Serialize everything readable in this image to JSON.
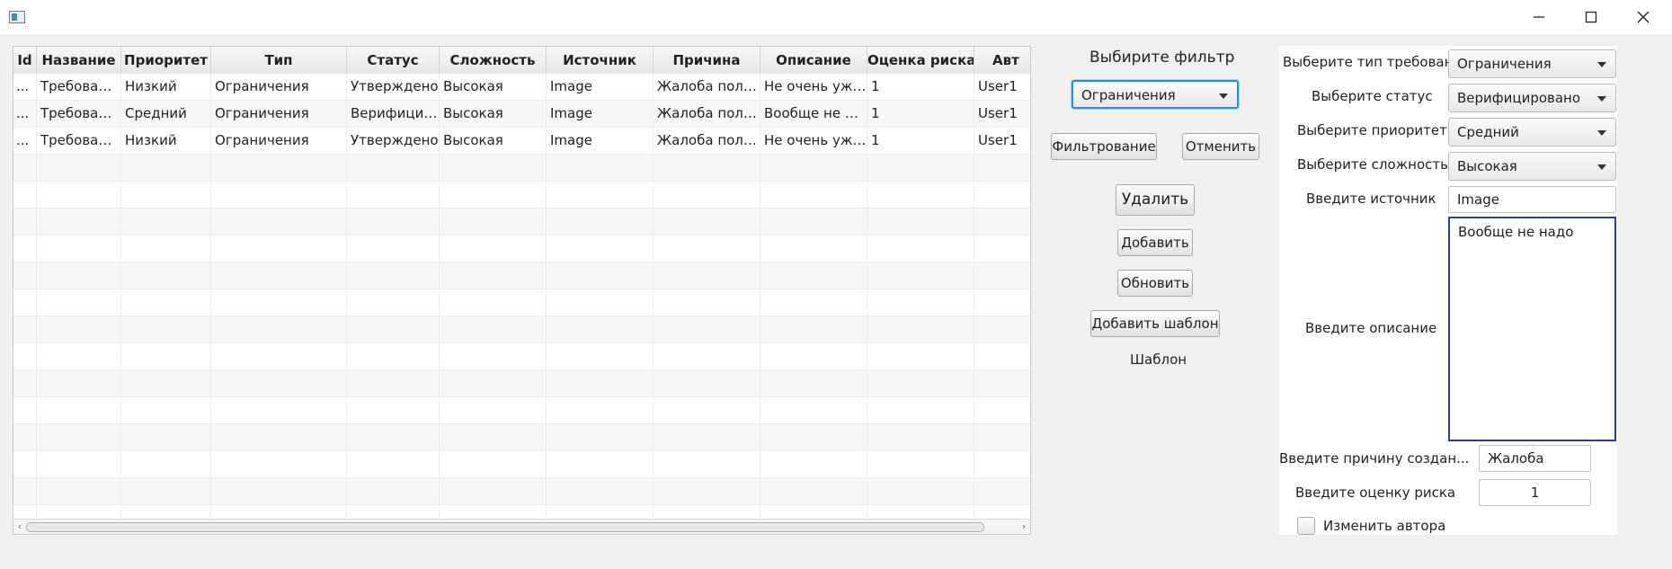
{
  "window": {
    "title_icon": "app-window-icon",
    "controls": [
      "minimize-icon",
      "maximize-icon",
      "close-icon"
    ]
  },
  "table": {
    "columns": [
      "Id",
      "Название",
      "Приоритет",
      "Тип",
      "Статус",
      "Сложность",
      "Источник",
      "Причина",
      "Описание",
      "Оценка риска",
      "Авт"
    ],
    "rows": [
      [
        "...",
        "Требование",
        "Низкий",
        "Ограничения",
        "Утверждено",
        "Высокая",
        "Image",
        "Жалоба польз...",
        "Не очень уж ...",
        "1",
        "User1"
      ],
      [
        "...",
        "Требование",
        "Средний",
        "Ограничения",
        "Верифицир...",
        "Высокая",
        "Image",
        "Жалоба польз...",
        "Вообще не на...",
        "1",
        "User1"
      ],
      [
        "...",
        "Требование",
        "Низкий",
        "Ограничения",
        "Утверждено",
        "Высокая",
        "Image",
        "Жалоба польз...",
        "Не очень уж ...",
        "1",
        "User1"
      ]
    ]
  },
  "filter": {
    "title": "Выбирите фильтр",
    "selected": "Ограничения",
    "apply_label": "Фильтрование",
    "cancel_label": "Отменить"
  },
  "actions": {
    "delete_label": "Удалить",
    "add_label": "Добавить",
    "refresh_label": "Обновить",
    "add_template_label": "Добавить шаблон",
    "template_label": "Шаблон"
  },
  "form": {
    "type_label": "Выберите тип требования",
    "type_value": "Ограничения",
    "status_label": "Выберите статус",
    "status_value": "Верифицировано",
    "priority_label": "Выберите приоритет",
    "priority_value": "Средний",
    "complexity_label": "Выберите сложность",
    "complexity_value": "Высокая",
    "source_label": "Введите источник",
    "source_value": "Image",
    "description_label": "Введите описание",
    "description_value": "Вообще не надо",
    "reason_label": "Введите причину создан...",
    "reason_value": "Жалоба пользо",
    "risk_label": "Введите оценку риска",
    "risk_value": "1",
    "change_author_label": "Изменить автора"
  }
}
